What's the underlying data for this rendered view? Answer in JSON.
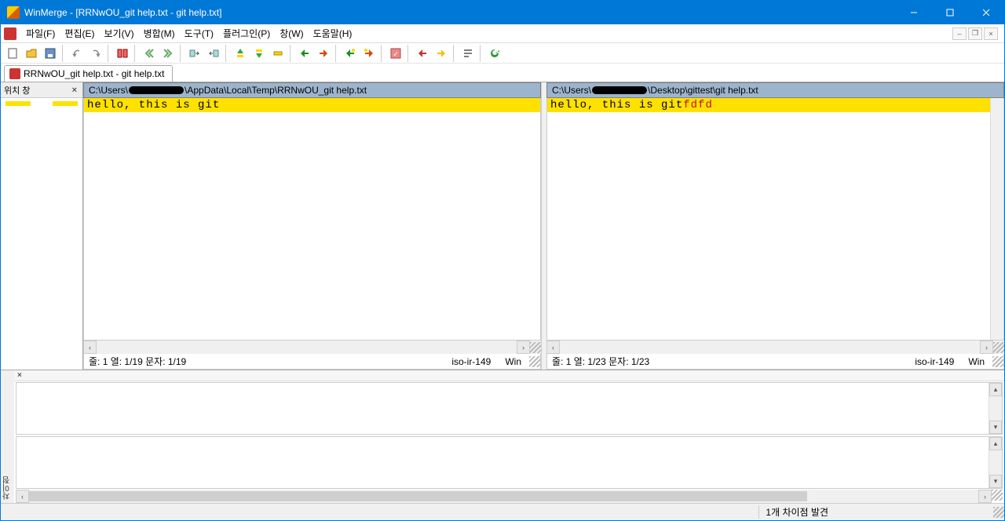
{
  "titlebar": {
    "title": "WinMerge - [RRNwOU_git help.txt - git help.txt]"
  },
  "menu": {
    "file": "파일(F)",
    "edit": "편집(E)",
    "view": "보기(V)",
    "merge": "병합(M)",
    "tools": "도구(T)",
    "plugins": "플러그인(P)",
    "window": "창(W)",
    "help": "도움말(H)"
  },
  "tab": {
    "label": "RRNwOU_git help.txt - git help.txt"
  },
  "location_pane": {
    "title": "위치 창"
  },
  "left": {
    "path_prefix": "C:\\Users\\",
    "path_suffix": "\\AppData\\Local\\Temp\\RRNwOU_git help.txt",
    "content_same": "hello, this is git",
    "status_pos": "줄: 1  열: 1/19  문자: 1/19",
    "encoding": "iso-ir-149",
    "eol": "Win"
  },
  "right": {
    "path_prefix": "C:\\Users\\",
    "path_suffix": "\\Desktop\\gittest\\git help.txt",
    "content_same": "hello, this is git",
    "content_added": "fdfd",
    "status_pos": "줄: 1  열: 1/23  문자: 1/23",
    "encoding": "iso-ir-149",
    "eol": "Win"
  },
  "lower_sidebar": "차이점",
  "statusbar": {
    "diff_found": "1개 차이점 발견"
  }
}
